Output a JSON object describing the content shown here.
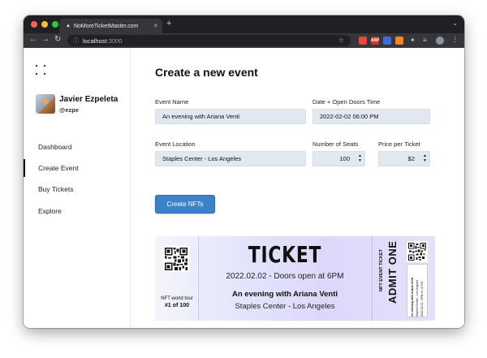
{
  "browser": {
    "tab_title": "NoMoreTicketMaster.com",
    "tab_close": "×",
    "new_tab": "+",
    "tab_menu": "⌄",
    "url_host": "localhost",
    "url_port": ":3000",
    "ext_labels": [
      "",
      "ABP",
      "",
      "",
      ""
    ]
  },
  "user": {
    "name": "Javier Ezpeleta",
    "handle": "@ezpe"
  },
  "nav": [
    "Dashboard",
    "Create Event",
    "Buy Tickets",
    "Explore"
  ],
  "form": {
    "title": "Create a new event",
    "event_name_label": "Event Name",
    "event_name_value": "An evening with Ariana Venti",
    "date_label": "Date + Open Doors Time",
    "date_value": "2022-02-02   06:00 PM",
    "location_label": "Event Location",
    "location_value": "Staples Center - Los Angeles",
    "seats_label": "Number of Seats",
    "seats_value": "100",
    "price_label": "Price per Ticket",
    "price_value": "$2",
    "submit_label": "Create NFTs"
  },
  "ticket": {
    "stub_line1": "NFT world tour",
    "stub_line2": "#1 of 100",
    "title": "TICKET",
    "date_line": "2022.02.02 - Doors open at 6PM",
    "event_name": "An evening with Ariana Venti",
    "location": "Staples Center - Los Angeles",
    "vertical_small": "NFT EVENT TICKET",
    "vertical_big": "ADMIT ONE",
    "right_stub_line1": "An evening with Ariana Venti",
    "right_stub_line2": "Staples Center - Los Angeles",
    "right_stub_line3": "2022.02.02 - 6PM  #1 of 100"
  },
  "colors": {
    "primary": "#3b82c8",
    "input_bg": "#e2e8f0",
    "ticket_gradient_start": "#f4f5fb",
    "ticket_gradient_end": "#e6e0fb"
  }
}
